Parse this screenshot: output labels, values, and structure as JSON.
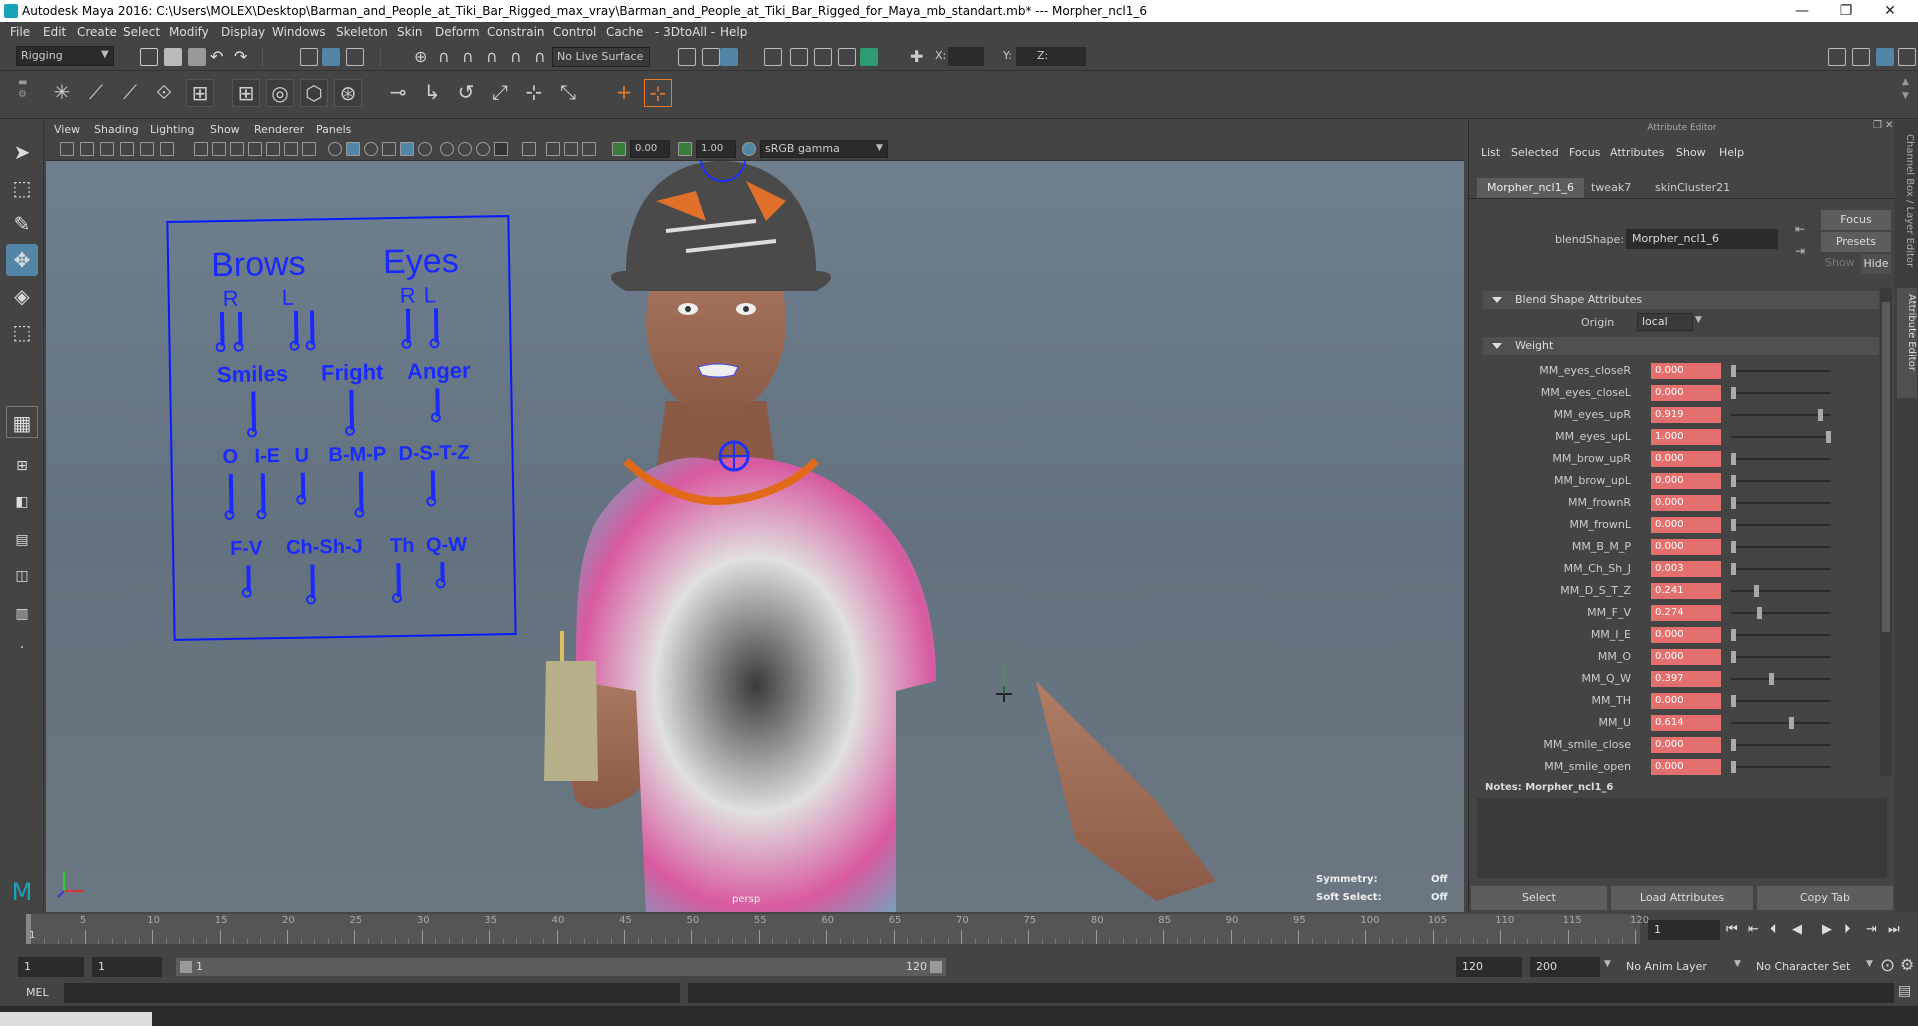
{
  "title_bar": {
    "text": "Autodesk Maya 2016: C:\\Users\\MOLEX\\Desktop\\Barman_and_People_at_Tiki_Bar_Rigged_max_vray\\Barman_and_People_at_Tiki_Bar_Rigged_for_Maya_mb_standart.mb*   ---   Morpher_ncl1_6",
    "minimize": "—",
    "restore": "❐",
    "close": "✕"
  },
  "menu": [
    "File",
    "Edit",
    "Create",
    "Select",
    "Modify",
    "Display",
    "Windows",
    "Skeleton",
    "Skin",
    "Deform",
    "Constrain",
    "Control",
    "Cache",
    "- 3DtoAll -",
    "Help"
  ],
  "shelf": {
    "mode": "Rigging",
    "live_surface": "No Live Surface",
    "x_label": "X:",
    "y_label": "Y:",
    "z_label": "Z:"
  },
  "viewport": {
    "menu": [
      "View",
      "Shading",
      "Lighting",
      "Show",
      "Renderer",
      "Panels"
    ],
    "exposure": "0.00",
    "gamma": "1.00",
    "color_space": "sRGB gamma",
    "camera": "persp",
    "symmetry_label": "Symmetry:",
    "symmetry_value": "Off",
    "soft_select_label": "Soft Select:",
    "soft_select_value": "Off"
  },
  "face_panel": {
    "brows": "Brows",
    "eyes": "Eyes",
    "r1": "R",
    "l1": "L",
    "r2": "R",
    "l2": "L",
    "smiles": "Smiles",
    "fright": "Fright",
    "anger": "Anger",
    "o": "O",
    "ie": "I-E",
    "u": "U",
    "bmp": "B-M-P",
    "dstz": "D-S-T-Z",
    "fv": "F-V",
    "chshj": "Ch-Sh-J",
    "th": "Th",
    "qw": "Q-W"
  },
  "attribute_editor": {
    "title": "Attribute Editor",
    "menu": [
      "List",
      "Selected",
      "Focus",
      "Attributes",
      "Show",
      "Help"
    ],
    "tabs": [
      "Morpher_ncl1_6",
      "tweak7",
      "skinCluster21"
    ],
    "blendshape_label": "blendShape:",
    "blendshape_value": "Morpher_ncl1_6",
    "focus_btn": "Focus",
    "presets_btn": "Presets",
    "show_label": "Show",
    "hide_btn": "Hide",
    "section_blend": "Blend Shape Attributes",
    "origin_label": "Origin",
    "origin_value": "local",
    "section_weight": "Weight",
    "weights": [
      {
        "name": "MM_eyes_closeR",
        "value": "0.000",
        "frac": 0.0
      },
      {
        "name": "MM_eyes_closeL",
        "value": "0.000",
        "frac": 0.0
      },
      {
        "name": "MM_eyes_upR",
        "value": "0.919",
        "frac": 0.919
      },
      {
        "name": "MM_eyes_upL",
        "value": "1.000",
        "frac": 1.0
      },
      {
        "name": "MM_brow_upR",
        "value": "0.000",
        "frac": 0.0
      },
      {
        "name": "MM_brow_upL",
        "value": "0.000",
        "frac": 0.0
      },
      {
        "name": "MM_frownR",
        "value": "0.000",
        "frac": 0.0
      },
      {
        "name": "MM_frownL",
        "value": "0.000",
        "frac": 0.0
      },
      {
        "name": "MM_B_M_P",
        "value": "0.000",
        "frac": 0.0
      },
      {
        "name": "MM_Ch_Sh_J",
        "value": "0.003",
        "frac": 0.003
      },
      {
        "name": "MM_D_S_T_Z",
        "value": "0.241",
        "frac": 0.241
      },
      {
        "name": "MM_F_V",
        "value": "0.274",
        "frac": 0.274
      },
      {
        "name": "MM_I_E",
        "value": "0.000",
        "frac": 0.0
      },
      {
        "name": "MM_O",
        "value": "0.000",
        "frac": 0.0
      },
      {
        "name": "MM_Q_W",
        "value": "0.397",
        "frac": 0.397
      },
      {
        "name": "MM_TH",
        "value": "0.000",
        "frac": 0.0
      },
      {
        "name": "MM_U",
        "value": "0.614",
        "frac": 0.614
      },
      {
        "name": "MM_smile_close",
        "value": "0.000",
        "frac": 0.0
      },
      {
        "name": "MM_smile_open",
        "value": "0.000",
        "frac": 0.0
      }
    ],
    "notes_label": "Notes:  Morpher_ncl1_6",
    "select_btn": "Select",
    "load_btn": "Load Attributes",
    "copy_btn": "Copy Tab"
  },
  "side_strip": {
    "channel_box": "Channel Box / Layer Editor",
    "attribute_editor": "Attribute Editor"
  },
  "timeline": {
    "ticks": [
      "5",
      "10",
      "15",
      "20",
      "25",
      "30",
      "35",
      "40",
      "45",
      "50",
      "55",
      "60",
      "65",
      "70",
      "75",
      "80",
      "85",
      "90",
      "95",
      "100",
      "105",
      "110",
      "115",
      "120"
    ],
    "current_frame": "1",
    "ruler_start": "1"
  },
  "range": {
    "start": "1",
    "start2": "1",
    "slider_start": "1",
    "slider_end": "120",
    "end": "120",
    "end2": "200",
    "anim_layer": "No Anim Layer",
    "character_set": "No Character Set"
  },
  "cmd": {
    "label": "MEL"
  },
  "colors": {
    "accent": "#5285a6",
    "weight_field": "#e46f6f",
    "panel_blue": "#1a2aff"
  }
}
